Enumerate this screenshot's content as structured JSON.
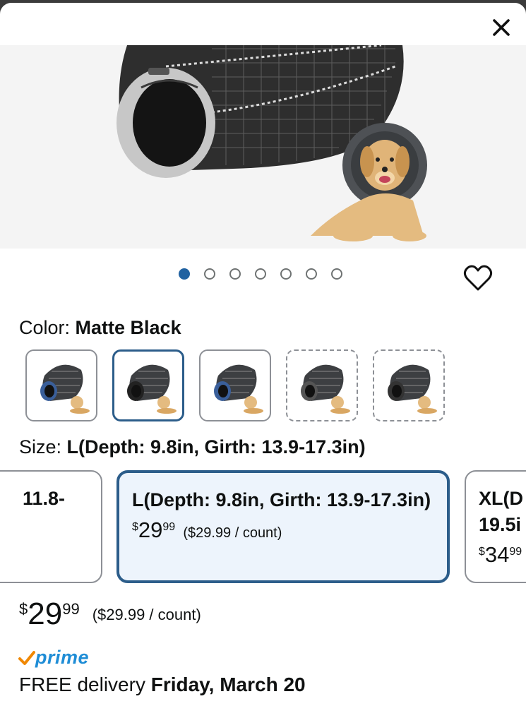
{
  "close": {
    "icon": "close-icon"
  },
  "gallery": {
    "dot_count": 7,
    "active_index": 0,
    "favorite_icon": "heart-icon"
  },
  "color": {
    "label": "Color: ",
    "value": "Matte Black",
    "swatches": [
      {
        "name": "blue-inner-variant",
        "selected": false,
        "available": true
      },
      {
        "name": "matte-black-variant",
        "selected": true,
        "available": true
      },
      {
        "name": "blue-trim-variant",
        "selected": false,
        "available": true
      },
      {
        "name": "gray-variant",
        "selected": false,
        "available": false
      },
      {
        "name": "dark-variant",
        "selected": false,
        "available": false
      }
    ]
  },
  "size": {
    "label": "Size: ",
    "value": "L(Depth: 9.8in, Girth: 13.9-17.3in)",
    "options": [
      {
        "name": "11.8-",
        "currency": "",
        "price_whole": "",
        "price_fraction": "",
        "unit_price": ""
      },
      {
        "name": "L(Depth: 9.8in, Girth: 13.9-17.3in)",
        "currency": "$",
        "price_whole": "29",
        "price_fraction": "99",
        "unit_price": "($29.99 / count)"
      },
      {
        "name": "XL(D\n19.5i",
        "currency": "$",
        "price_whole": "34",
        "price_fraction": "99",
        "unit_price": ""
      }
    ]
  },
  "price": {
    "currency": "$",
    "whole": "29",
    "fraction": "99",
    "unit_price": "($29.99 / count)"
  },
  "prime": {
    "check_icon": "prime-check-icon",
    "label": "prime"
  },
  "delivery": {
    "prefix": "FREE delivery ",
    "date": "Friday, March 20"
  },
  "colors": {
    "accent": "#2c5d8a",
    "active_dot": "#2162a1",
    "selected_bg": "#edf4fc",
    "prime_blue": "#1f8dd6",
    "prime_orange": "#f08804"
  }
}
